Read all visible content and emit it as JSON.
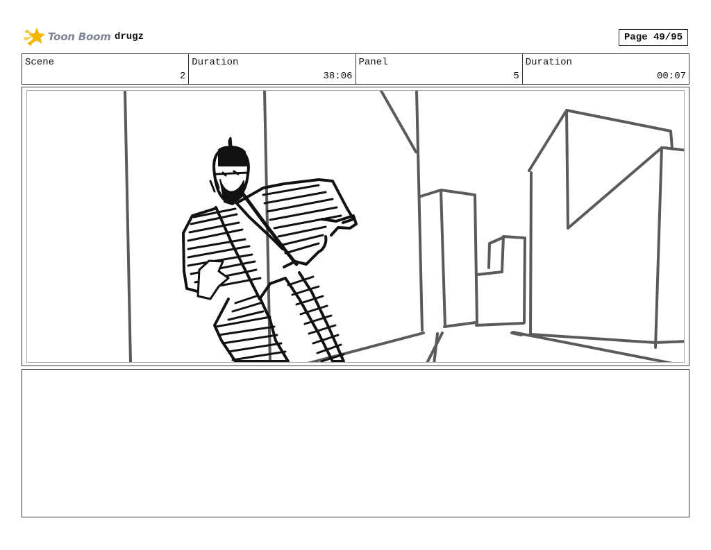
{
  "header": {
    "logo": {
      "text": "Toon Boom",
      "icon": "toon-boom-star-icon",
      "color": "#f2b705"
    },
    "project_name": "drugz",
    "page": "Page 49/95"
  },
  "info": [
    {
      "label": "Scene",
      "value": "2"
    },
    {
      "label": "Duration",
      "value": "38:06"
    },
    {
      "label": "Panel",
      "value": "5"
    },
    {
      "label": "Duration",
      "value": "00:07"
    }
  ],
  "panel": {
    "image": "storyboard-sketch-man-in-suit-city-street"
  },
  "notes": {
    "text": ""
  }
}
